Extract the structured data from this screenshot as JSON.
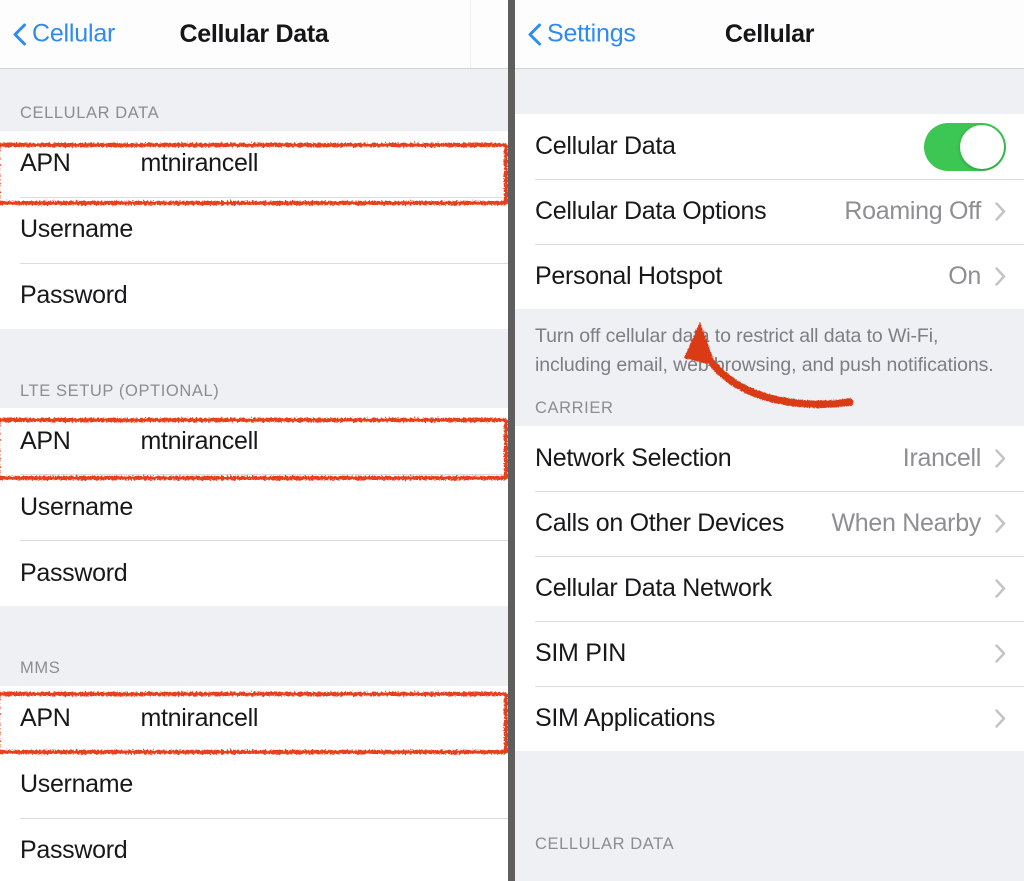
{
  "left_panel": {
    "nav": {
      "back_label": "Cellular",
      "title": "Cellular Data",
      "back_icon": "chevron-left-icon"
    },
    "sections": [
      {
        "header": "CELLULAR DATA",
        "rows": [
          {
            "label": "APN",
            "value": "mtnirancell",
            "highlighted": true
          },
          {
            "label": "Username",
            "value": ""
          },
          {
            "label": "Password",
            "value": ""
          }
        ]
      },
      {
        "header": "LTE SETUP (OPTIONAL)",
        "rows": [
          {
            "label": "APN",
            "value": "mtnirancell",
            "highlighted": true
          },
          {
            "label": "Username",
            "value": ""
          },
          {
            "label": "Password",
            "value": ""
          }
        ]
      },
      {
        "header": "MMS",
        "rows": [
          {
            "label": "APN",
            "value": "mtnirancell",
            "highlighted": true
          },
          {
            "label": "Username",
            "value": ""
          },
          {
            "label": "Password",
            "value": ""
          }
        ]
      }
    ]
  },
  "right_panel": {
    "nav": {
      "back_label": "Settings",
      "title": "Cellular",
      "back_icon": "chevron-left-icon"
    },
    "group_one": {
      "cellular_data": {
        "label": "Cellular Data",
        "toggle_on": true
      },
      "cellular_data_options": {
        "label": "Cellular Data Options",
        "value": "Roaming Off",
        "chevron": "chevron-right-icon"
      },
      "personal_hotspot": {
        "label": "Personal Hotspot",
        "value": "On",
        "chevron": "chevron-right-icon"
      },
      "footer": "Turn off cellular data to restrict all data to Wi-Fi, including email, web browsing, and push notifications."
    },
    "carrier_section": {
      "header": "CARRIER",
      "rows": [
        {
          "label": "Network Selection",
          "value": "Irancell",
          "chevron": "chevron-right-icon"
        },
        {
          "label": "Calls on Other Devices",
          "value": "When Nearby",
          "chevron": "chevron-right-icon"
        },
        {
          "label": "Cellular Data Network",
          "value": "",
          "chevron": "chevron-right-icon"
        },
        {
          "label": "SIM PIN",
          "value": "",
          "chevron": "chevron-right-icon"
        },
        {
          "label": "SIM Applications",
          "value": "",
          "chevron": "chevron-right-icon"
        }
      ]
    },
    "bottom_section": {
      "header": "CELLULAR DATA"
    }
  },
  "annotations": {
    "highlight_color": "#e8401c",
    "arrow_color": "#d93a19",
    "arrow_target": "cellular-data-toggle"
  },
  "colors": {
    "accent_blue": "#2e8bf0",
    "toggle_green": "#3cc653",
    "group_background": "#eff0f4",
    "row_background": "#ffffff",
    "secondary_text": "#8e8e93"
  }
}
